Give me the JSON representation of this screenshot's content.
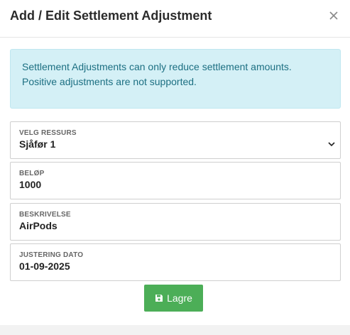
{
  "modal": {
    "title": "Add / Edit Settlement Adjustment",
    "close_icon": "close-icon"
  },
  "alert": {
    "line1": "Settlement Adjustments can only reduce settlement amounts.",
    "line2": "Positive adjustments are not supported."
  },
  "fields": {
    "resource": {
      "label": "VELG RESSURS",
      "value": "Sjåfør 1",
      "icon": "chevron-down-icon"
    },
    "amount": {
      "label": "BELØP",
      "value": "1000"
    },
    "description": {
      "label": "BESKRIVELSE",
      "value": "AirPods"
    },
    "date": {
      "label": "JUSTERING DATO",
      "value": "01-09-2025"
    }
  },
  "save_button": {
    "label": "Lagre",
    "icon": "save-icon"
  },
  "colors": {
    "alert_bg": "#d4f0f6",
    "alert_text": "#1c6f82",
    "save_green": "#4cae57"
  }
}
